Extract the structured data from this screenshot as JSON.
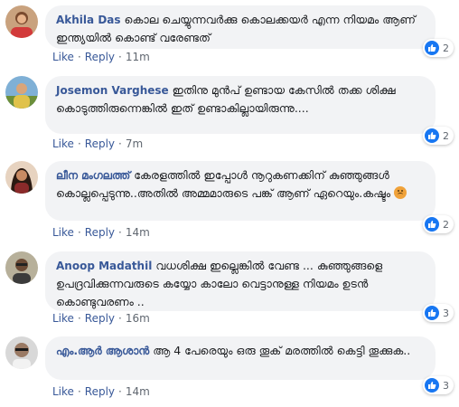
{
  "actions": {
    "like": "Like",
    "reply": "Reply",
    "separator": "·"
  },
  "colors": {
    "author": "#385898",
    "bubble": "#f2f3f5",
    "like_blue": "#1877f2"
  },
  "comments": [
    {
      "author": "Akhila Das",
      "text": "കൊല ചെയ്യുന്നവർക്കു കൊലക്കയർ എന്ന നിയമം ആണ് ഇന്ത്യയിൽ കൊണ്ട് വരേണ്ടത്",
      "reactions": "2",
      "time": "11m",
      "avatar_icon": "user-avatar"
    },
    {
      "author": "Josemon Varghese",
      "text": "ഇതിനു മുൻപ് ഉണ്ടായ കേസിൽ തക്ക ശിക്ഷ കൊടുത്തിരുന്നെങ്കിൽ ഇത് ഉണ്ടാകില്ലായിരുന്നു....",
      "reactions": "2",
      "time": "7m",
      "avatar_icon": "user-avatar"
    },
    {
      "author": "ലീന മംഗലത്ത്",
      "text": "കേരളത്തിൽ ഇപ്പോൾ നൂറുകണക്കിന് കുഞ്ഞുങ്ങൾ കൊല്ലപ്പെടുന്നു..അതിൽ അമ്മമാരുടെ പങ്ക് ആണ് ഏറെയും.കഷ്ടം",
      "reactions": "2",
      "time": "14m",
      "avatar_icon": "user-avatar",
      "emoji": "sad-face-emoji"
    },
    {
      "author": "Anoop Madathil",
      "text": "വധശിക്ഷ ഇല്ലെങ്കിൽ വേണ്ട ... കുഞ്ഞുങ്ങളെ ഉപദ്രവിക്കുന്നവരുടെ കയ്യോ കാലോ വെട്ടാനുള്ള നിയമം ഉടൻ കൊണ്ടുവരണം ..",
      "reactions": "3",
      "time": "16m",
      "avatar_icon": "user-avatar"
    },
    {
      "author": "എം.ആർ ആശാൻ",
      "text": "ആ 4 പേരെയും ഒരു തൂക് മരത്തിൽ കെട്ടി തൂക്കുക..",
      "reactions": "3",
      "time": "14m",
      "avatar_icon": "user-avatar"
    }
  ]
}
